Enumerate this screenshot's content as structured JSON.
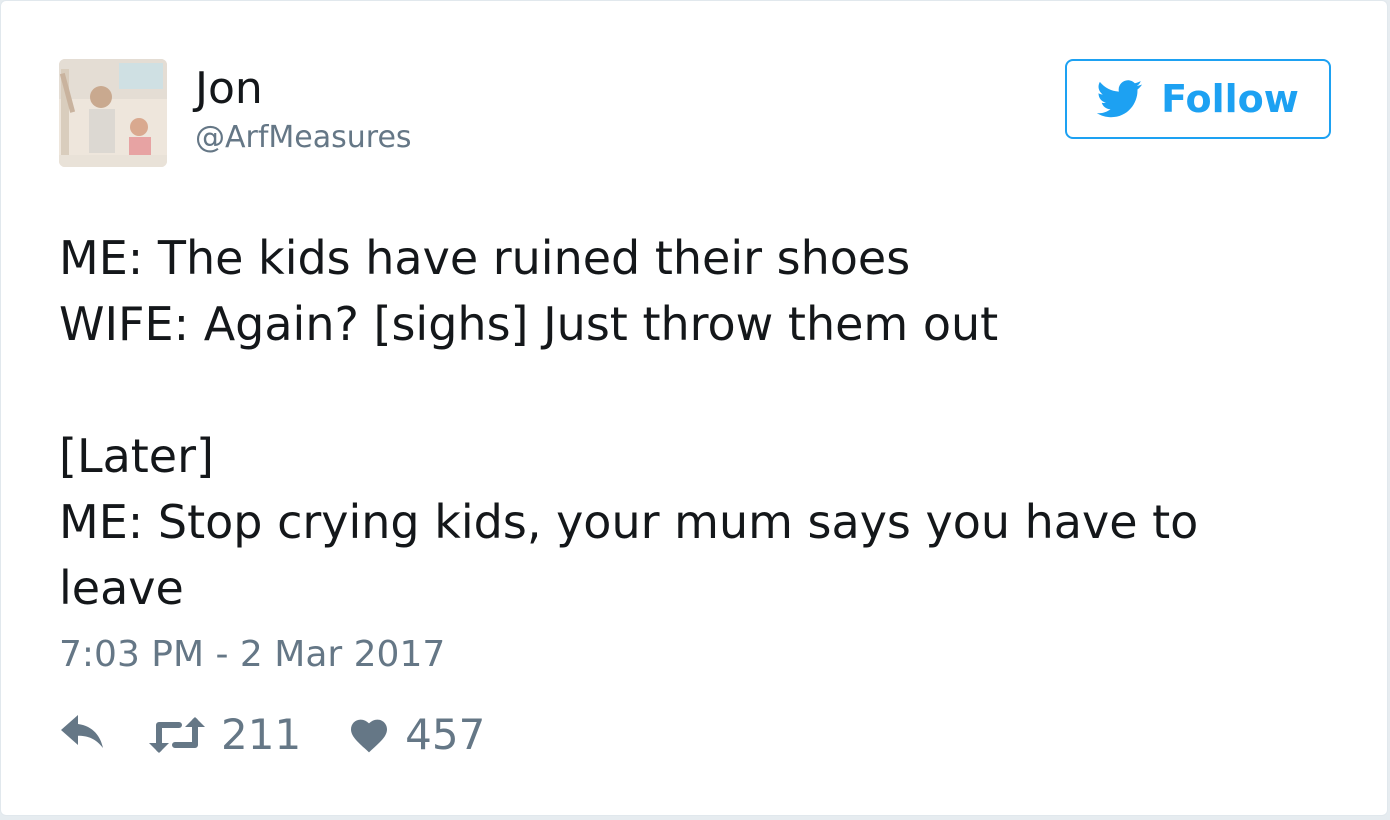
{
  "author": {
    "name": "Jon",
    "handle": "@ArfMeasures",
    "avatar": "profile-photo"
  },
  "follow_button": {
    "label": "Follow",
    "icon": "twitter-bird-icon",
    "color": "#1da1f2"
  },
  "tweet": {
    "lines": [
      "ME: The kids have ruined their shoes",
      "WIFE: Again? [sighs] Just throw them out",
      "",
      "[Later]",
      "ME: Stop crying kids, your mum says you have to",
      "leave"
    ],
    "timestamp": "7:03 PM - 2 Mar 2017"
  },
  "actions": {
    "reply": {
      "icon": "reply-icon"
    },
    "retweet": {
      "icon": "retweet-icon",
      "count": "211"
    },
    "like": {
      "icon": "heart-icon",
      "count": "457"
    }
  },
  "colors": {
    "text": "#14171a",
    "secondary": "#657786",
    "accent": "#1da1f2"
  }
}
